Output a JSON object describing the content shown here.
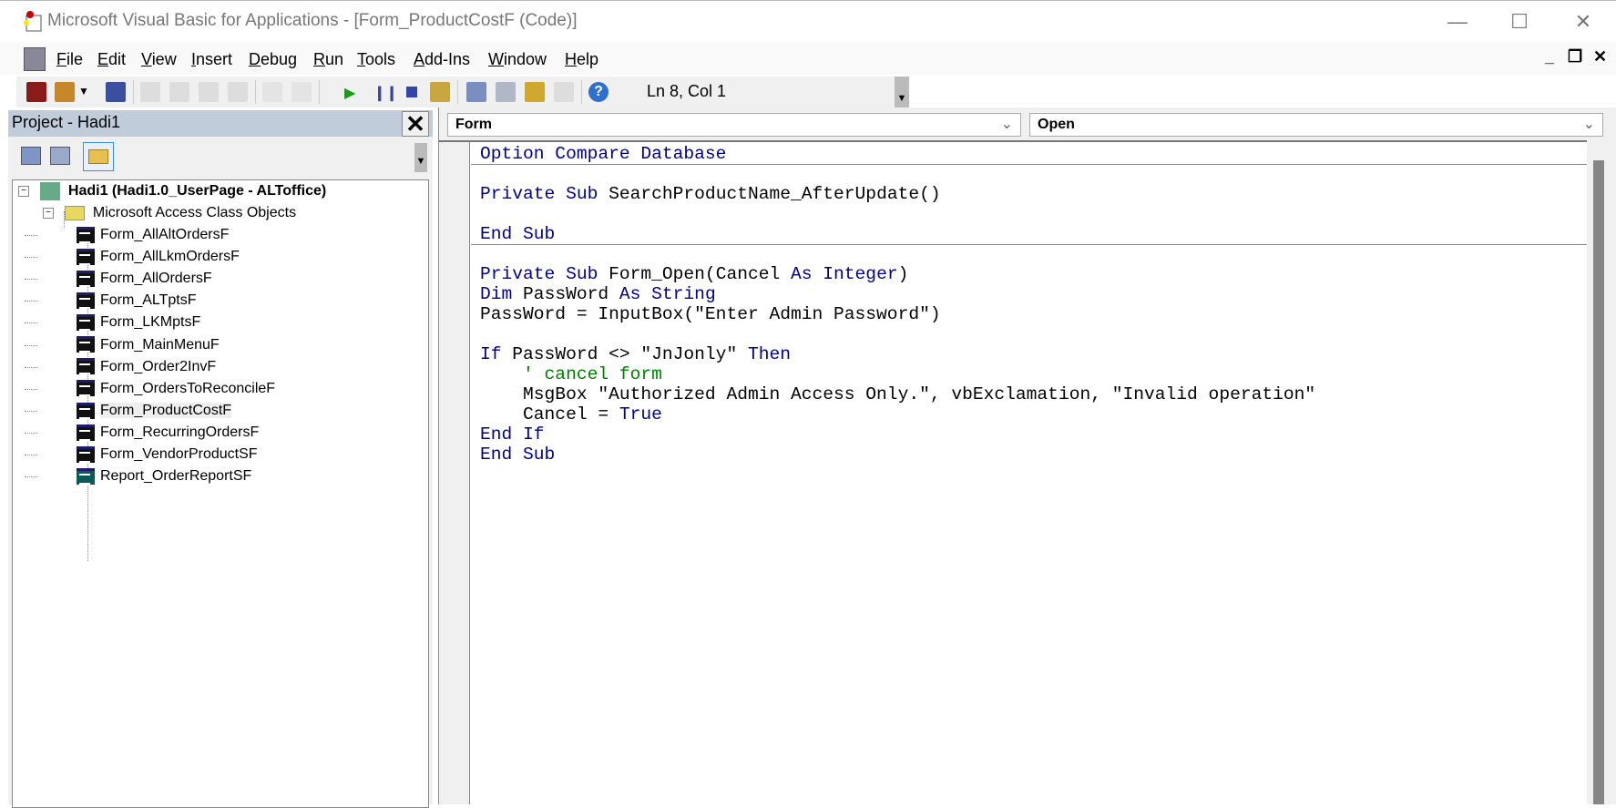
{
  "window": {
    "title": "Microsoft Visual Basic for Applications - [Form_ProductCostF (Code)]"
  },
  "menu": [
    "File",
    "Edit",
    "View",
    "Insert",
    "Debug",
    "Run",
    "Tools",
    "Add-Ins",
    "Window",
    "Help"
  ],
  "toolbar": {
    "position": "Ln 8, Col 1"
  },
  "project": {
    "title": "Project - Hadi1",
    "root": "Hadi1 (Hadi1.0_UserPage - ALToffice)",
    "folder": "Microsoft Access Class Objects",
    "items": [
      "Form_AllAltOrdersF",
      "Form_AllLkmOrdersF",
      "Form_AllOrdersF",
      "Form_ALTptsF",
      "Form_LKMptsF",
      "Form_MainMenuF",
      "Form_Order2InvF",
      "Form_OrdersToReconcileF",
      "Form_ProductCostF",
      "Form_RecurringOrdersF",
      "Form_VendorProductSF",
      "Report_OrderReportSF"
    ],
    "selected": "Form_ProductCostF"
  },
  "editor": {
    "object": "Form",
    "procedure": "Open",
    "lines": [
      [
        [
          "kw",
          "Option Compare Database"
        ]
      ],
      [],
      [
        [
          "kw",
          "Private Sub "
        ],
        [
          "p",
          "SearchProductName_AfterUpdate()"
        ]
      ],
      [],
      [
        [
          "kw",
          "End Sub"
        ]
      ],
      [],
      [
        [
          "kw",
          "Private Sub "
        ],
        [
          "p",
          "Form_Open(Cancel "
        ],
        [
          "kw",
          "As Integer"
        ],
        [
          "p",
          ")"
        ]
      ],
      [
        [
          "kw",
          "Dim "
        ],
        [
          "p",
          "PassWord "
        ],
        [
          "kw",
          "As String"
        ]
      ],
      [
        [
          "p",
          "PassWord = InputBox(\"Enter Admin Password\")"
        ]
      ],
      [],
      [
        [
          "kw",
          "If "
        ],
        [
          "p",
          "PassWord <> \"JnJonly\" "
        ],
        [
          "kw",
          "Then"
        ]
      ],
      [
        [
          "cm",
          "    ' cancel form"
        ]
      ],
      [
        [
          "p",
          "    MsgBox \"Authorized Admin Access Only.\", vbExclamation, \"Invalid operation\""
        ]
      ],
      [
        [
          "p",
          "    Cancel = "
        ],
        [
          "kw",
          "True"
        ]
      ],
      [
        [
          "kw",
          "End If"
        ]
      ],
      [
        [
          "kw",
          "End Sub"
        ]
      ]
    ]
  }
}
